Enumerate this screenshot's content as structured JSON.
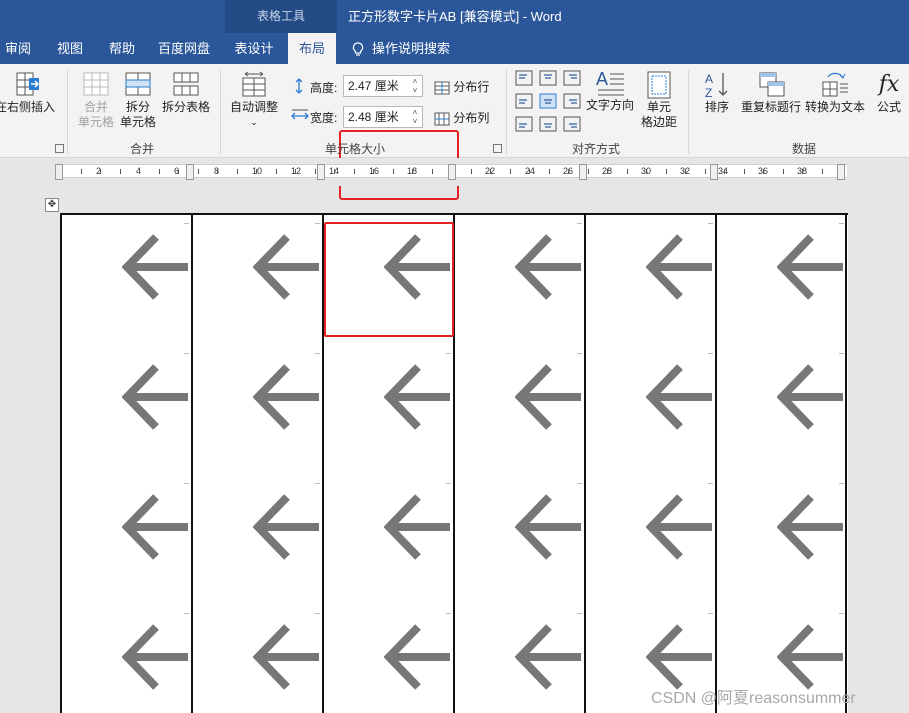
{
  "title_bar": {
    "tool_context": "表格工具",
    "doc_title": "正方形数字卡片AB [兼容模式] - Word"
  },
  "tabs": [
    {
      "label": "审阅",
      "active": false
    },
    {
      "label": "视图",
      "active": false
    },
    {
      "label": "帮助",
      "active": false
    },
    {
      "label": "百度网盘",
      "active": false
    },
    {
      "label": "表设计",
      "active": false
    },
    {
      "label": "布局",
      "active": true
    }
  ],
  "tell_me": {
    "label": "操作说明搜索",
    "icon": "lightbulb-icon"
  },
  "ribbon": {
    "rows_cols": {
      "insert_right": "在右侧插入"
    },
    "merge": {
      "group_label": "合并",
      "merge_cells_l1": "合并",
      "merge_cells_l2": "单元格",
      "split_cells_l1": "拆分",
      "split_cells_l2": "单元格",
      "split_table": "拆分表格"
    },
    "cell_size": {
      "group_label": "单元格大小",
      "autofit": "自动调整",
      "height_label": "高度:",
      "height_value": "2.47 厘米",
      "width_label": "宽度:",
      "width_value": "2.48 厘米",
      "distribute_rows": "分布行",
      "distribute_cols": "分布列"
    },
    "alignment": {
      "group_label": "对齐方式",
      "text_direction": "文字方向",
      "cell_margins_l1": "单元",
      "cell_margins_l2": "格边距"
    },
    "data": {
      "group_label": "数据",
      "sort": "排序",
      "repeat_header": "重复标题行",
      "convert_text": "转换为文本",
      "formula": "公式",
      "formula_icon_text": "fx"
    }
  },
  "ruler": {
    "numbers": [
      "2",
      "4",
      "6",
      "8",
      "10",
      "12",
      "14",
      "16",
      "18",
      "22",
      "24",
      "26",
      "28",
      "30",
      "32",
      "34",
      "36",
      "38"
    ]
  },
  "document": {
    "table": {
      "rows": 4,
      "cols": 6,
      "cell_content": "left-arrow-icon",
      "arrow_color": "#777777"
    },
    "move_handle": "✥"
  },
  "watermark": "CSDN @阿夏reasonsummer"
}
